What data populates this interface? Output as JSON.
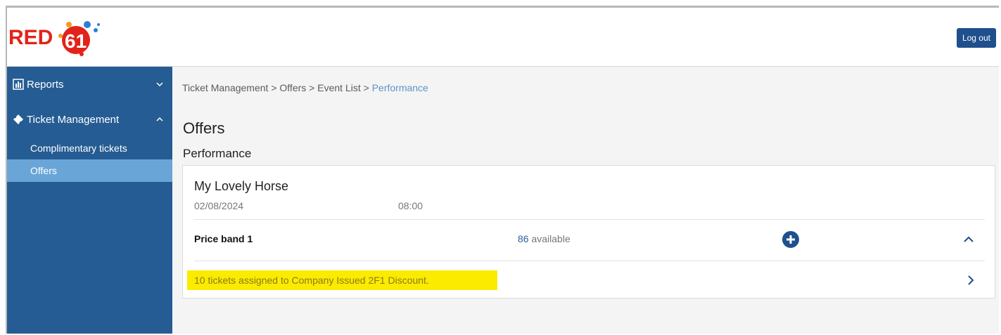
{
  "header": {
    "logo_text": "RED 61",
    "logout_label": "Log out"
  },
  "sidebar": {
    "sections": [
      {
        "label": "Reports",
        "expanded": false,
        "icon": "bar-chart-icon"
      },
      {
        "label": "Ticket Management",
        "expanded": true,
        "icon": "ticket-icon"
      }
    ],
    "items": [
      {
        "label": "Complimentary tickets",
        "active": false
      },
      {
        "label": "Offers",
        "active": true
      }
    ]
  },
  "breadcrumb": {
    "items": [
      "Ticket Management",
      "Offers",
      "Event List"
    ],
    "separator": ">",
    "current": "Performance"
  },
  "page": {
    "title": "Offers",
    "section": "Performance"
  },
  "event": {
    "name": "My Lovely Horse",
    "date": "02/08/2024",
    "time": "08:00"
  },
  "price_band": {
    "name": "Price band 1",
    "available_count": "86",
    "available_label": "available"
  },
  "offer": {
    "text": "10 tickets assigned to Company Issued 2F1 Discount."
  },
  "colors": {
    "sidebar": "#255c93",
    "sidebar_active": "#6aa5d7",
    "accent": "#1f4f8c",
    "highlight": "#fbeb00",
    "logo_red": "#e2231a"
  }
}
